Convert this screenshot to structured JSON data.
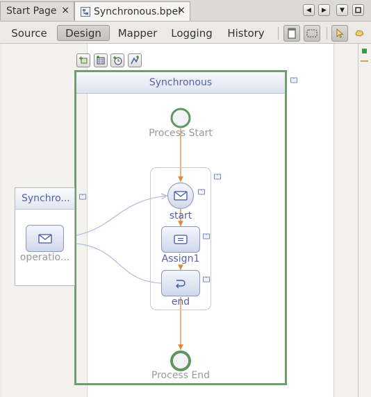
{
  "tabs": [
    {
      "label": "Start Page",
      "close": "×"
    },
    {
      "label": "Synchronous.bpel",
      "close": "×"
    }
  ],
  "view_tabs": [
    "Source",
    "Design",
    "Mapper",
    "Logging",
    "History"
  ],
  "active_view": "Design",
  "process": {
    "name": "Synchronous",
    "start_label": "Process Start",
    "end_label": "Process End"
  },
  "activities": [
    {
      "label": "start",
      "type": "receive"
    },
    {
      "label": "Assign1",
      "type": "assign"
    },
    {
      "label": "end",
      "type": "reply"
    }
  ],
  "partner_link": {
    "title": "Synchro...",
    "operation": "operatio..."
  },
  "colors": {
    "process_border": "#6e9e6d",
    "flow_arrow": "#e0893a",
    "message_link": "#b8bde0",
    "label_blue": "#5560a8"
  }
}
